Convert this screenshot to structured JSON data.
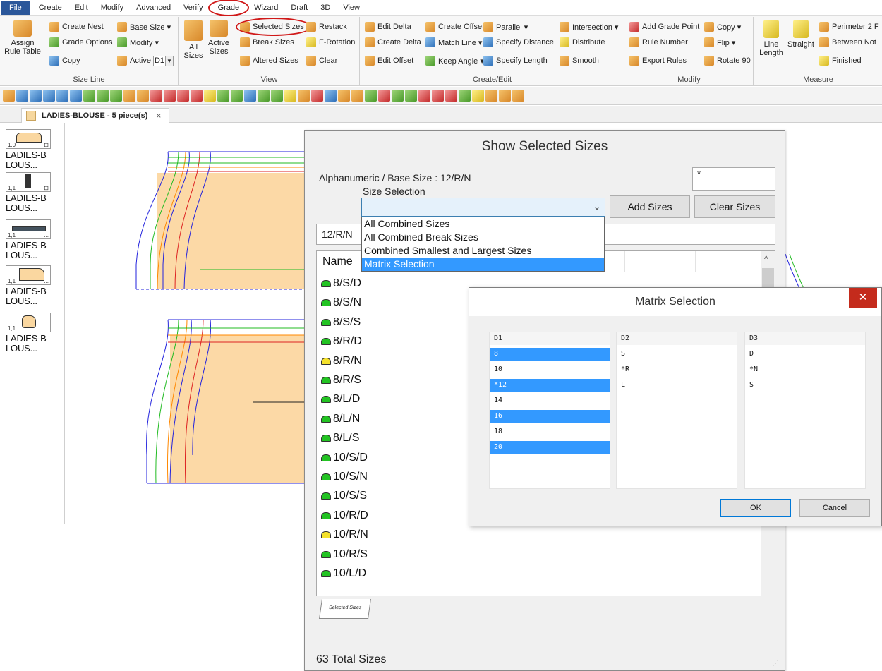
{
  "menu": {
    "items": [
      "File",
      "Create",
      "Edit",
      "Modify",
      "Advanced",
      "Verify",
      "Grade",
      "Wizard",
      "Draft",
      "3D",
      "View"
    ]
  },
  "ribbon": {
    "size_line": {
      "label": "Size Line",
      "assign_rule_table": "Assign\nRule Table",
      "create_nest": "Create Nest",
      "grade_options": "Grade Options",
      "copy": "Copy",
      "base_size": "Base Size ▾",
      "modify": "Modify ▾",
      "active_label": "Active",
      "active_value": "D1"
    },
    "view": {
      "label": "View",
      "all_sizes": "All\nSizes",
      "active_sizes": "Active\nSizes",
      "selected_sizes": "Selected Sizes",
      "break_sizes": "Break Sizes",
      "altered_sizes": "Altered Sizes",
      "restack": "Restack",
      "f_rotation": "F-Rotation",
      "clear": "Clear"
    },
    "create_edit": {
      "label": "Create/Edit",
      "edit_delta": "Edit Delta",
      "create_delta": "Create Delta",
      "edit_offset": "Edit Offset",
      "create_offset": "Create Offset",
      "match_line": "Match Line ▾",
      "keep_angle": "Keep Angle ▾",
      "parallel": "Parallel ▾",
      "specify_distance": "Specify Distance",
      "specify_length": "Specify Length",
      "intersection": "Intersection ▾",
      "distribute": "Distribute",
      "smooth": "Smooth"
    },
    "modify": {
      "label": "Modify",
      "add_grade_point": "Add Grade Point",
      "rule_number": "Rule Number",
      "export_rules": "Export Rules",
      "copy": "Copy ▾",
      "flip": "Flip ▾",
      "rotate_90": "Rotate 90"
    },
    "measure": {
      "label": "Measure",
      "line_length": "Line\nLength",
      "straight": "Straight",
      "perimeter": "Perimeter 2 F",
      "between": "Between Not",
      "finished": "Finished"
    }
  },
  "document": {
    "tab_title": "LADIES-BLOUSE - 5 piece(s)",
    "close": "×"
  },
  "pieces": [
    {
      "num": "1,0",
      "mark": "⊟",
      "label": "LADIES-B\nLOUS..."
    },
    {
      "num": "1,1",
      "mark": "⊟",
      "label": "LADIES-B\nLOUS..."
    },
    {
      "num": "1,1",
      "mark": "...",
      "label": "LADIES-B\nLOUS..."
    },
    {
      "num": "1,1",
      "mark": "...",
      "label": "LADIES-B\nLOUS..."
    },
    {
      "num": "1,1",
      "mark": "...",
      "label": "LADIES-B\nLOUS..."
    }
  ],
  "show_selected_sizes": {
    "title": "Show Selected Sizes",
    "base_size_label": "Alphanumeric / Base Size : 12/R/N",
    "size_selection_label": "Size Selection",
    "star_field": "*",
    "add_sizes": "Add Sizes",
    "clear_sizes": "Clear Sizes",
    "base_field": "12/R/N",
    "list_header": "Name",
    "sizes": [
      {
        "name": "8/S/D",
        "color": "green"
      },
      {
        "name": "8/S/N",
        "color": "green"
      },
      {
        "name": "8/S/S",
        "color": "green"
      },
      {
        "name": "8/R/D",
        "color": "green"
      },
      {
        "name": "8/R/N",
        "color": "yellow"
      },
      {
        "name": "8/R/S",
        "color": "green"
      },
      {
        "name": "8/L/D",
        "color": "green"
      },
      {
        "name": "8/L/N",
        "color": "green"
      },
      {
        "name": "8/L/S",
        "color": "green"
      },
      {
        "name": "10/S/D",
        "color": "green"
      },
      {
        "name": "10/S/N",
        "color": "green"
      },
      {
        "name": "10/S/S",
        "color": "green"
      },
      {
        "name": "10/R/D",
        "color": "green"
      },
      {
        "name": "10/R/N",
        "color": "yellow"
      },
      {
        "name": "10/R/S",
        "color": "green"
      },
      {
        "name": "10/L/D",
        "color": "green"
      }
    ],
    "tab_label": "Selected Sizes",
    "total": "63 Total Sizes"
  },
  "size_selection_dropdown": {
    "options": [
      "All Combined Sizes",
      "All Combined Break Sizes",
      "Combined Smallest and Largest Sizes",
      "Matrix Selection"
    ],
    "highlighted_index": 3
  },
  "matrix_selection": {
    "title": "Matrix Selection",
    "close": "✕",
    "columns": [
      {
        "header": "D1",
        "rows": [
          {
            "v": "8",
            "sel": true
          },
          {
            "v": "10",
            "sel": false
          },
          {
            "v": "*12",
            "sel": true
          },
          {
            "v": "14",
            "sel": false
          },
          {
            "v": "16",
            "sel": true
          },
          {
            "v": "18",
            "sel": false
          },
          {
            "v": "20",
            "sel": true
          }
        ]
      },
      {
        "header": "D2",
        "rows": [
          {
            "v": "S",
            "sel": false
          },
          {
            "v": "*R",
            "sel": false
          },
          {
            "v": "L",
            "sel": false
          }
        ]
      },
      {
        "header": "D3",
        "rows": [
          {
            "v": "D",
            "sel": false
          },
          {
            "v": "*N",
            "sel": false
          },
          {
            "v": "S",
            "sel": false
          }
        ]
      }
    ],
    "ok": "OK",
    "cancel": "Cancel"
  },
  "colors": {
    "accent": "#3399ff",
    "file_menu": "#2b579a",
    "highlight_circle": "#d01818",
    "piece_fill": "#fad7a0",
    "close_button": "#c42b1c"
  }
}
